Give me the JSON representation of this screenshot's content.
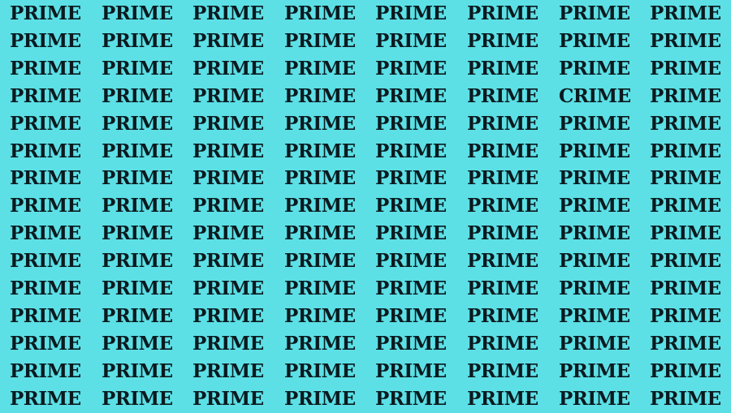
{
  "puzzle": {
    "background_color": "#5ce0e6",
    "text_color": "#0a1a1f",
    "rows": [
      [
        "PRIME",
        "PRIME",
        "PRIME",
        "PRIME",
        "PRIME",
        "PRIME",
        "PRIME",
        "PRIME"
      ],
      [
        "PRIME",
        "PRIME",
        "PRIME",
        "PRIME",
        "PRIME",
        "PRIME",
        "PRIME",
        "PRIME"
      ],
      [
        "PRIME",
        "PRIME",
        "PRIME",
        "PRIME",
        "PRIME",
        "PRIME",
        "PRIME",
        "PRIME"
      ],
      [
        "PRIME",
        "PRIME",
        "PRIME",
        "PRIME",
        "PRIME",
        "PRIME",
        "CRIME",
        "PRIME"
      ],
      [
        "PRIME",
        "PRIME",
        "PRIME",
        "PRIME",
        "PRIME",
        "PRIME",
        "PRIME",
        "PRIME"
      ],
      [
        "PRIME",
        "PRIME",
        "PRIME",
        "PRIME",
        "PRIME",
        "PRIME",
        "PRIME",
        "PRIME"
      ],
      [
        "PRIME",
        "PRIME",
        "PRIME",
        "PRIME",
        "PRIME",
        "PRIME",
        "PRIME",
        "PRIME"
      ],
      [
        "PRIME",
        "PRIME",
        "PRIME",
        "PRIME",
        "PRIME",
        "PRIME",
        "PRIME",
        "PRIME"
      ],
      [
        "PRIME",
        "PRIME",
        "PRIME",
        "PRIME",
        "PRIME",
        "PRIME",
        "PRIME",
        "PRIME"
      ],
      [
        "PRIME",
        "PRIME",
        "PRIME",
        "PRIME",
        "PRIME",
        "PRIME",
        "PRIME",
        "PRIME"
      ],
      [
        "PRIME",
        "PRIME",
        "PRIME",
        "PRIME",
        "PRIME",
        "PRIME",
        "PRIME",
        "PRIME"
      ],
      [
        "PRIME",
        "PRIME",
        "PRIME",
        "PRIME",
        "PRIME",
        "PRIME",
        "PRIME",
        "PRIME"
      ],
      [
        "PRIME",
        "PRIME",
        "PRIME",
        "PRIME",
        "PRIME",
        "PRIME",
        "PRIME",
        "PRIME"
      ],
      [
        "PRIME",
        "PRIME",
        "PRIME",
        "PRIME",
        "PRIME",
        "PRIME",
        "PRIME",
        "PRIME"
      ],
      [
        "PRIME",
        "PRIME",
        "PRIME",
        "PRIME",
        "PRIME",
        "PRIME",
        "PRIME",
        "PRIME"
      ]
    ]
  }
}
